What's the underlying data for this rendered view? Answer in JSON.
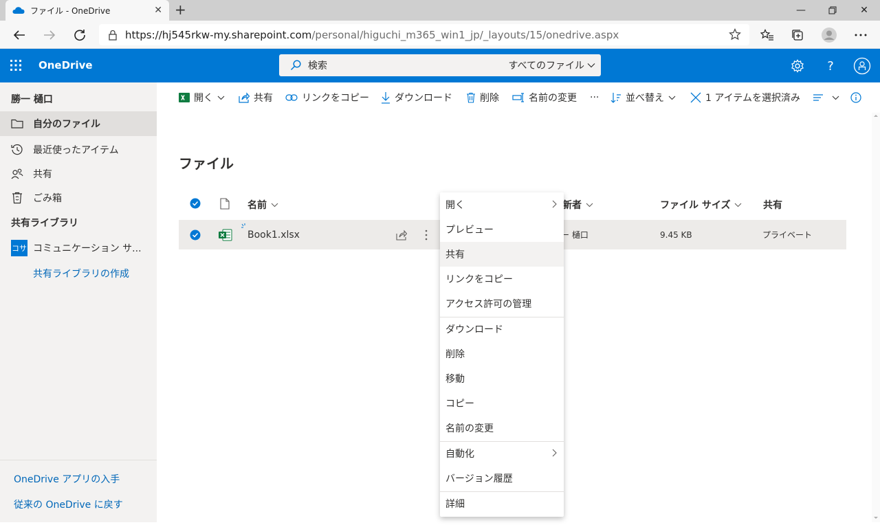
{
  "browser": {
    "tab_title": "ファイル - OneDrive",
    "url_host": "https://hj545rkw-my.sharepoint.com",
    "url_path": "/personal/higuchi_m365_win1_jp/_layouts/15/onedrive.aspx"
  },
  "suite": {
    "brand": "OneDrive",
    "search_placeholder": "検索",
    "search_scope": "すべてのファイル"
  },
  "nav": {
    "user_name": "勝一 樋口",
    "items": [
      {
        "label": "自分のファイル"
      },
      {
        "label": "最近使ったアイテム"
      },
      {
        "label": "共有"
      },
      {
        "label": "ごみ箱"
      }
    ],
    "shared_libraries_label": "共有ライブラリ",
    "library_badge": "コサ",
    "library_name": "コミュニケーション サ...",
    "create_library": "共有ライブラリの作成",
    "get_app": "OneDrive アプリの入手",
    "classic": "従来の OneDrive に戻す"
  },
  "commands": {
    "open": "開く",
    "share": "共有",
    "copy_link": "リンクをコピー",
    "download": "ダウンロード",
    "delete": "削除",
    "rename": "名前の変更",
    "more": "···",
    "sort": "並べ替え",
    "selected": "1 アイテムを選択済み"
  },
  "main": {
    "title": "ファイル",
    "columns": {
      "name": "名前",
      "modified_by": "更新者",
      "size": "ファイル サイズ",
      "sharing": "共有"
    },
    "rows": [
      {
        "name": "Book1.xlsx",
        "modified_by": "勝一 樋口",
        "modified_by_visible": "ー 樋口",
        "size": "9.45 KB",
        "sharing": "プライベート"
      }
    ]
  },
  "context_menu": {
    "items": [
      "開く",
      "プレビュー",
      "共有",
      "リンクをコピー",
      "アクセス許可の管理",
      "ダウンロード",
      "削除",
      "移動",
      "コピー",
      "名前の変更",
      "自動化",
      "バージョン履歴",
      "詳細"
    ]
  },
  "colors": {
    "brand": "#0078d4",
    "excel": "#107c41",
    "nav_bg": "#f3f2f1"
  }
}
